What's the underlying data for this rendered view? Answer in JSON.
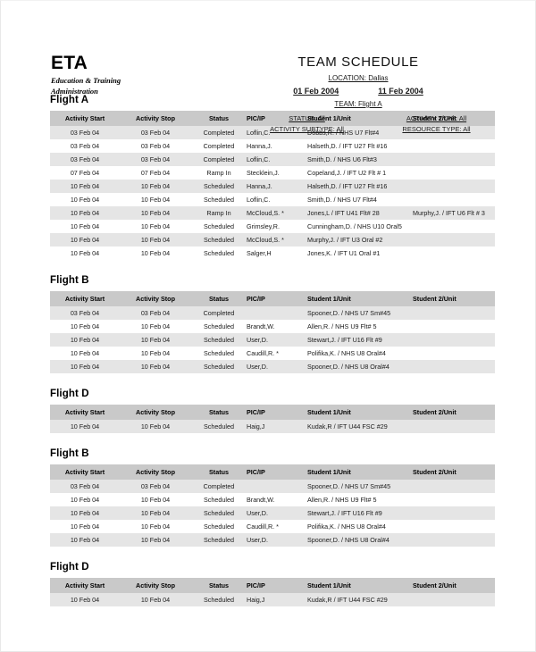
{
  "brand": {
    "title": "ETA",
    "line1": "Education & Training",
    "line2": "Administration"
  },
  "header": {
    "doc_title": "TEAM SCHEDULE",
    "location": "LOCATION: Dallas",
    "date_from": "01 Feb 2004",
    "date_to": "11 Feb 2004",
    "team": "TEAM: Flight A",
    "filters": {
      "status": "STATUS: All",
      "activity_type": "ACTIVITY TYPE: All",
      "activity_subtype": "ACTIVITY SUBTYPE: All",
      "resource_type": "RESOURCE TYPE: All"
    }
  },
  "columns": [
    "Activity Start",
    "Activity Stop",
    "Status",
    "PIC/IP",
    "Student 1/Unit",
    "Student 2/Unit"
  ],
  "sections": [
    {
      "title": "Flight A",
      "rows": [
        [
          "03 Feb 04",
          "03 Feb 04",
          "Completed",
          "Loflin,C.",
          "Dobbs,R. / NHS U7 Flt#4",
          ""
        ],
        [
          "03 Feb 04",
          "03 Feb 04",
          "Completed",
          "Hanna,J.",
          "Halseth,D. / IFT U27 Flt #16",
          ""
        ],
        [
          "03 Feb 04",
          "03 Feb 04",
          "Completed",
          "Loflin,C.",
          "Smith,D. / NHS U6 Flt#3",
          ""
        ],
        [
          "07 Feb 04",
          "07 Feb 04",
          "Ramp In",
          "Stecklein,J.",
          "Copeland,J. / IFT U2  Flt  # 1",
          ""
        ],
        [
          "10 Feb 04",
          "10 Feb 04",
          "Scheduled",
          "Hanna,J.",
          "Halseth,D. / IFT U27 Flt #16",
          ""
        ],
        [
          "10 Feb 04",
          "10 Feb 04",
          "Scheduled",
          "Loflin,C.",
          "Smith,D. / NHS U7 Flt#4",
          ""
        ],
        [
          "10 Feb 04",
          "10 Feb 04",
          "Ramp In",
          "McCloud,S. *",
          "Jones,L / IFT U41 Flt# 28",
          "Murphy,J. / IFT U6 Flt # 3"
        ],
        [
          "10 Feb 04",
          "10 Feb 04",
          "Scheduled",
          "Grimsley,R.",
          "Cunningham,D. / NHS U10 Oral5",
          ""
        ],
        [
          "10 Feb 04",
          "10 Feb 04",
          "Scheduled",
          "McCloud,S. *",
          "Murphy,J. / IFT U3 Oral #2",
          ""
        ],
        [
          "10 Feb 04",
          "10 Feb 04",
          "Scheduled",
          "Salger,H",
          "Jones,K. / IFT U1 Oral  #1",
          ""
        ]
      ]
    },
    {
      "title": "Flight B",
      "rows": [
        [
          "03 Feb 04",
          "03 Feb 04",
          "Completed",
          "",
          "Spooner,D. / NHS U7 Sm#45",
          ""
        ],
        [
          "10 Feb 04",
          "10 Feb 04",
          "Scheduled",
          "Brandt,W.",
          "Allen,R. / NHS U9 Flt# 5",
          ""
        ],
        [
          "10 Feb 04",
          "10 Feb 04",
          "Scheduled",
          "User,D.",
          "Stewart,J. / IFT U16 Flt #9",
          ""
        ],
        [
          "10 Feb 04",
          "10 Feb 04",
          "Scheduled",
          "Caudill,R. *",
          "Polifika,K. / NHS U8 Oral#4",
          ""
        ],
        [
          "10 Feb 04",
          "10 Feb 04",
          "Scheduled",
          "User,D.",
          "Spooner,D. / NHS U8 Oral#4",
          ""
        ]
      ]
    },
    {
      "title": "Flight D",
      "rows": [
        [
          "10 Feb 04",
          "10 Feb 04",
          "Scheduled",
          "Haig,J",
          "Kudak,R / IFT U44 FSC #29",
          ""
        ]
      ]
    },
    {
      "title": "Flight B",
      "rows": [
        [
          "03 Feb 04",
          "03 Feb 04",
          "Completed",
          "",
          "Spooner,D. / NHS U7 Sm#45",
          ""
        ],
        [
          "10 Feb 04",
          "10 Feb 04",
          "Scheduled",
          "Brandt,W.",
          "Allen,R. / NHS U9 Flt# 5",
          ""
        ],
        [
          "10 Feb 04",
          "10 Feb 04",
          "Scheduled",
          "User,D.",
          "Stewart,J. / IFT U16 Flt #9",
          ""
        ],
        [
          "10 Feb 04",
          "10 Feb 04",
          "Scheduled",
          "Caudill,R. *",
          "Polifika,K. / NHS U8 Oral#4",
          ""
        ],
        [
          "10 Feb 04",
          "10 Feb 04",
          "Scheduled",
          "User,D.",
          "Spooner,D. / NHS U8 Oral#4",
          ""
        ]
      ]
    },
    {
      "title": "Flight D",
      "rows": [
        [
          "10 Feb 04",
          "10 Feb 04",
          "Scheduled",
          "Haig,J",
          "Kudak,R / IFT U44 FSC #29",
          ""
        ]
      ]
    }
  ],
  "colors": {
    "header_row_bg": "#c9c9c9",
    "stripe_bg": "#e5e5e5",
    "page_bg": "#ffffff",
    "text": "#1a1a1a"
  }
}
